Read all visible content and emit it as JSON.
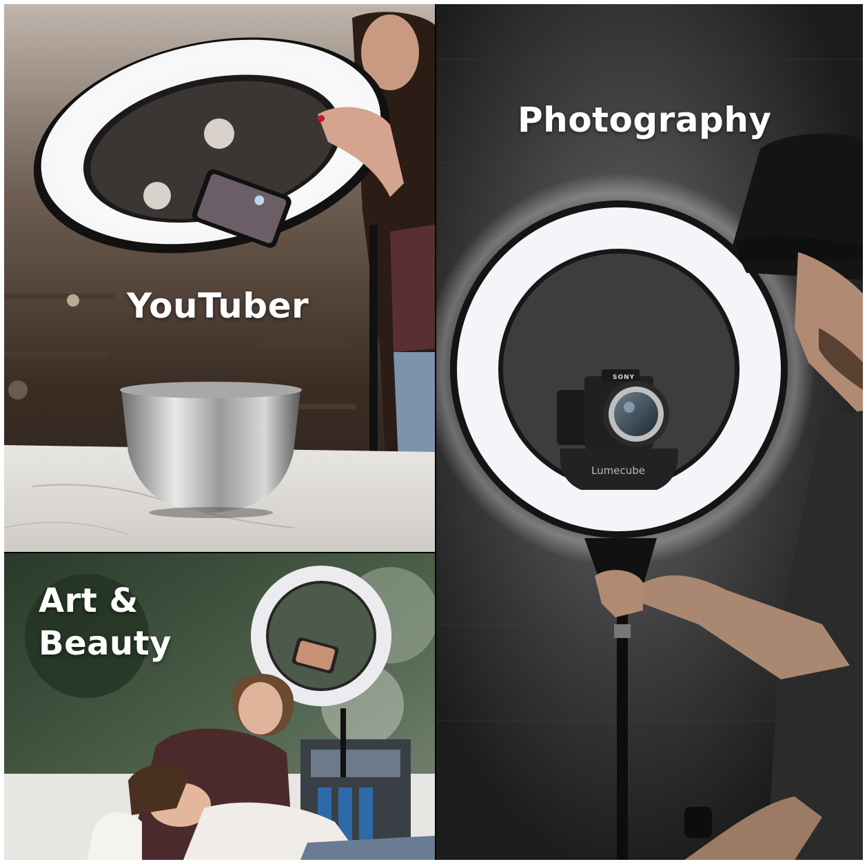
{
  "panels": {
    "youtuber": {
      "caption": "YouTuber"
    },
    "photography": {
      "caption": "Photography",
      "ring_brand": "Lumecube",
      "camera_brand": "SONY"
    },
    "art_beauty": {
      "caption_line1": "Art &",
      "caption_line2": "Beauty"
    }
  },
  "colors": {
    "caption_text": "#ffffff",
    "ring_light": "#f4f3f8",
    "background": "#ffffff"
  }
}
